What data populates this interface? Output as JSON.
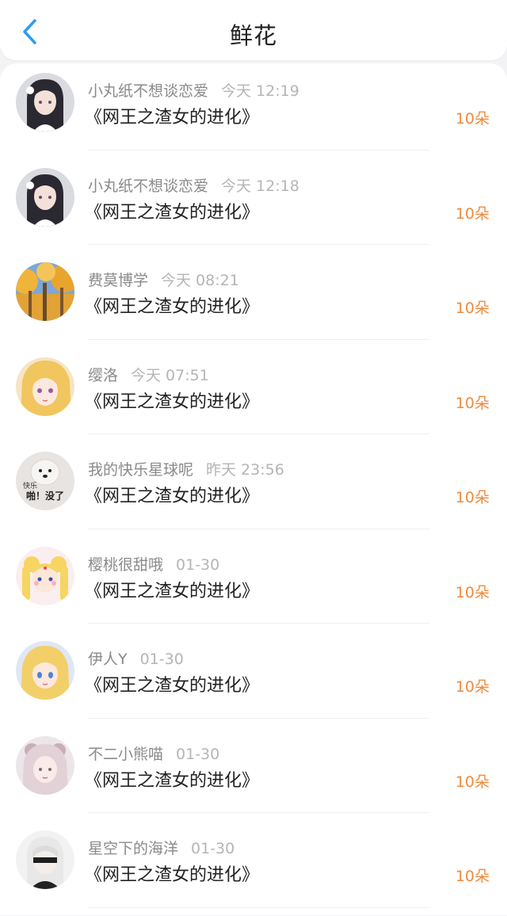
{
  "header": {
    "title": "鲜花",
    "back_icon": "chevron-left-icon",
    "accent_color": "#2d9cf0"
  },
  "list": [
    {
      "name": "小丸纸不想谈恋爱",
      "time": "今天 12:19",
      "book": "《网王之渣女的进化》",
      "amount": "10朵"
    },
    {
      "name": "小丸纸不想谈恋爱",
      "time": "今天 12:18",
      "book": "《网王之渣女的进化》",
      "amount": "10朵"
    },
    {
      "name": "费莫博学",
      "time": "今天 08:21",
      "book": "《网王之渣女的进化》",
      "amount": "10朵"
    },
    {
      "name": "缨洛",
      "time": "今天 07:51",
      "book": "《网王之渣女的进化》",
      "amount": "10朵"
    },
    {
      "name": "我的快乐星球呢",
      "time": "昨天 23:56",
      "book": "《网王之渣女的进化》",
      "amount": "10朵"
    },
    {
      "name": "樱桃很甜哦",
      "time": "01-30",
      "book": "《网王之渣女的进化》",
      "amount": "10朵"
    },
    {
      "name": "伊人Y",
      "time": "01-30",
      "book": "《网王之渣女的进化》",
      "amount": "10朵"
    },
    {
      "name": "不二小熊喵",
      "time": "01-30",
      "book": "《网王之渣女的进化》",
      "amount": "10朵"
    },
    {
      "name": "星空下的海洋",
      "time": "01-30",
      "book": "《网王之渣女的进化》",
      "amount": "10朵"
    }
  ],
  "avatar_text": {
    "line1": "快乐",
    "line2": "啪！没了"
  },
  "colors": {
    "amount": "#f08a3c",
    "username": "#8a8a8a",
    "time": "#b5b5b5"
  }
}
